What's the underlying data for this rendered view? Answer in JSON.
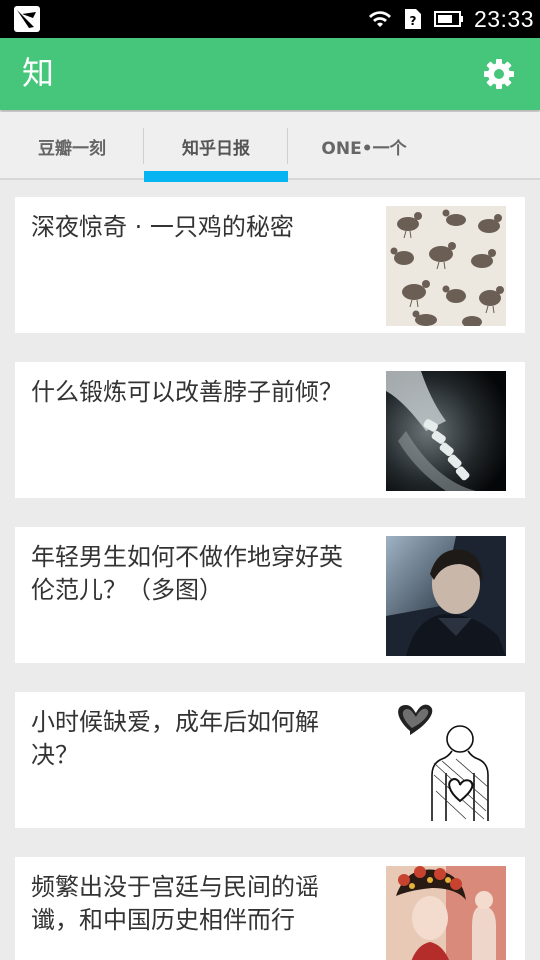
{
  "status_bar": {
    "time": "23:33"
  },
  "app_bar": {
    "title": "知"
  },
  "tabs": [
    {
      "label": "豆瓣一刻"
    },
    {
      "label": "知乎日报"
    },
    {
      "label": "ONE•一个"
    }
  ],
  "active_tab": "知乎日报",
  "stories": [
    {
      "title": "深夜惊奇 · 一只鸡的秘密",
      "thumb_icon": "chicken-pattern-image"
    },
    {
      "title": "什么锻炼可以改善脖子前倾？",
      "thumb_icon": "neck-xray-image"
    },
    {
      "title": "年轻男生如何不做作地穿好英伦范儿？（多图）",
      "thumb_icon": "man-in-car-image"
    },
    {
      "title": "小时候缺爱，成年后如何解决？",
      "thumb_icon": "heart-sketch-image"
    },
    {
      "title": "频繁出没于宫廷与民间的谣谶，和中国历史相伴而行",
      "thumb_icon": "palace-costume-image"
    }
  ],
  "colors": {
    "app_bar": "#45c67a",
    "tab_indicator": "#05b4f0",
    "background": "#ebebeb"
  }
}
